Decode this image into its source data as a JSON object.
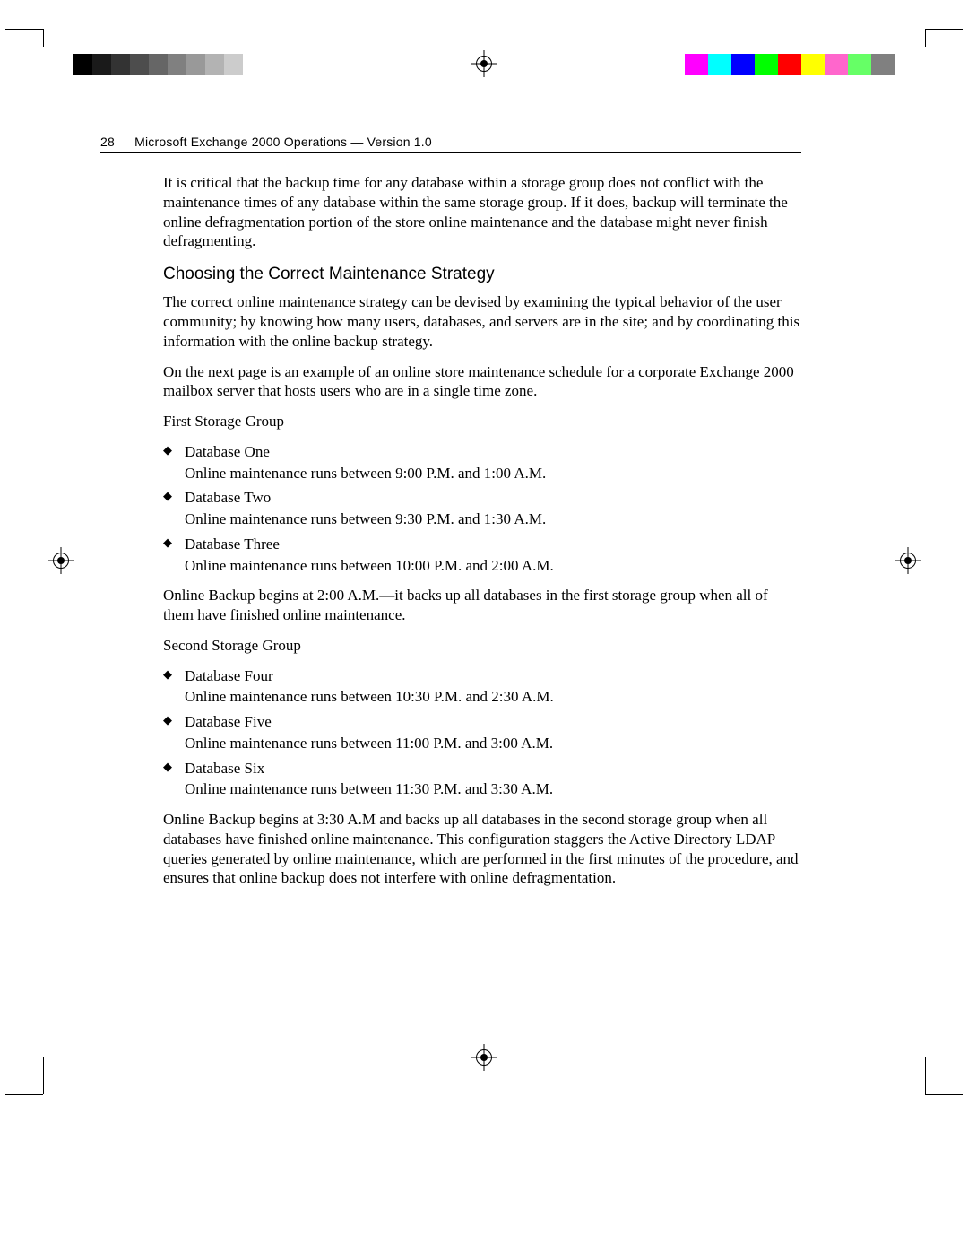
{
  "calibration": {
    "grayscale": [
      "#000000",
      "#1a1a1a",
      "#333333",
      "#4d4d4d",
      "#666666",
      "#808080",
      "#999999",
      "#b3b3b3",
      "#cccccc",
      "#ffffff"
    ],
    "colors": [
      "#ff00ff",
      "#00ffff",
      "#0000ff",
      "#00ff00",
      "#ff0000",
      "#ffff00",
      "#ff66cc",
      "#66ff66",
      "#808080"
    ]
  },
  "header": {
    "page_number": "28",
    "running_title": "Microsoft Exchange 2000 Operations — Version 1.0"
  },
  "body": {
    "intro": "It is critical that the backup time for any database within a storage group does not conflict with the maintenance times of any database within the same storage group. If it does, backup will terminate the online defragmentation portion of the store online maintenance and the database might never finish defragmenting.",
    "section_title": "Choosing the Correct Maintenance Strategy",
    "para1": "The correct online maintenance strategy can be devised by examining the typical behavior of the user community; by knowing how many users, databases, and servers are in the site; and by coordinating this information with the online backup strategy.",
    "para2": "On the next page is an example of an online store maintenance schedule for a corporate Exchange 2000 mailbox server that hosts users who are in a single time zone.",
    "group1_title": "First Storage Group",
    "group1_items": [
      {
        "name": "Database One",
        "detail": "Online maintenance runs between 9:00 P.M. and 1:00 A.M."
      },
      {
        "name": "Database Two",
        "detail": "Online maintenance runs between 9:30 P.M. and 1:30 A.M."
      },
      {
        "name": "Database Three",
        "detail": "Online maintenance runs between 10:00 P.M. and 2:00 A.M."
      }
    ],
    "group1_backup": "Online Backup begins at 2:00 A.M.—it backs up all databases in the first storage group when all of them have finished online maintenance.",
    "group2_title": "Second Storage Group",
    "group2_items": [
      {
        "name": "Database Four",
        "detail": "Online maintenance runs between 10:30 P.M. and 2:30 A.M."
      },
      {
        "name": "Database Five",
        "detail": "Online maintenance runs between 11:00 P.M. and 3:00 A.M."
      },
      {
        "name": "Database Six",
        "detail": "Online maintenance runs between 11:30 P.M. and 3:30 A.M."
      }
    ],
    "group2_backup": "Online Backup begins at 3:30 A.M and backs up all databases in the second storage group when all databases have finished online maintenance. This configuration staggers the Active Directory LDAP queries generated by online maintenance, which are performed in the first minutes of the procedure, and ensures that online backup does not interfere with online defragmentation."
  }
}
